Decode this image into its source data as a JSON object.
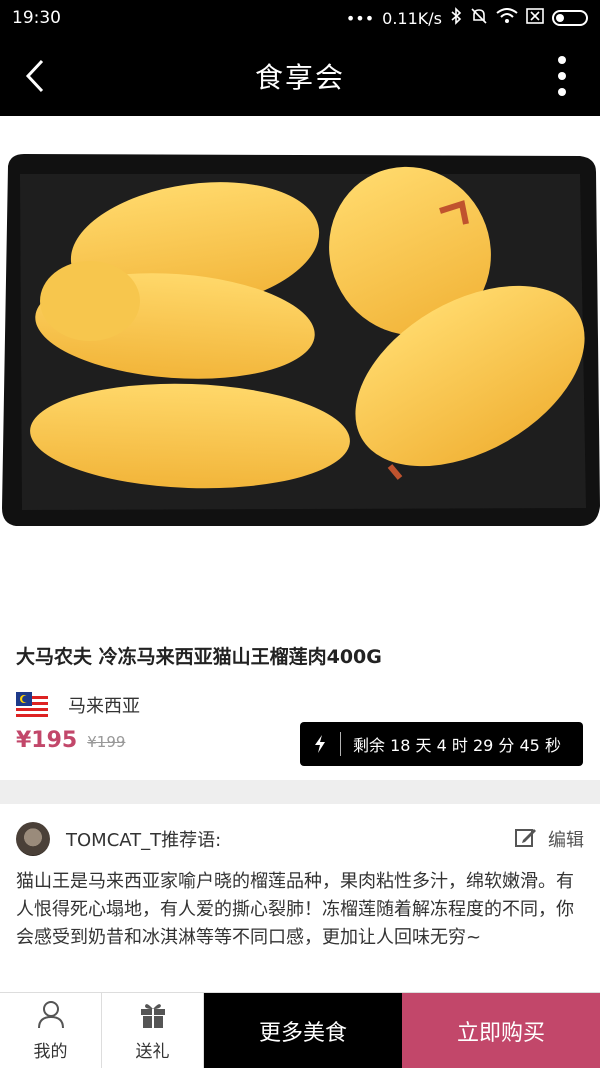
{
  "status_bar": {
    "time": "19:30",
    "network_speed": "0.11K/s",
    "icons": [
      "signal-dots-icon",
      "bluetooth-icon",
      "mute-icon",
      "wifi-icon",
      "sim-icon",
      "battery-icon"
    ]
  },
  "nav": {
    "title": "食享会",
    "back_icon": "back-arrow-icon",
    "more_icon": "more-vertical-icon"
  },
  "product": {
    "image_subject": "durian",
    "title": "大马农夫 冷冻马来西亚猫山王榴莲肉400G",
    "origin": "马来西亚",
    "price_current": "¥195",
    "price_original": "¥199",
    "countdown": {
      "text": "剩余 18 天 4 时 29 分 45 秒"
    }
  },
  "recommendation": {
    "user": "TOMCAT_T推荐语:",
    "edit_label": "编辑",
    "text": "猫山王是马来西亚家喻户晓的榴莲品种，果肉粘性多汁，绵软嫩滑。有人恨得死心塌地，有人爱的撕心裂肺！冻榴莲随着解冻程度的不同，你会感受到奶昔和冰淇淋等等不同口感，更加让人回味无穷~"
  },
  "bottom_bar": {
    "my_label": "我的",
    "gift_label": "送礼",
    "more_food_label": "更多美食",
    "buy_now_label": "立即购买"
  },
  "colors": {
    "accent": "#c2476a",
    "bar": "#000000"
  }
}
